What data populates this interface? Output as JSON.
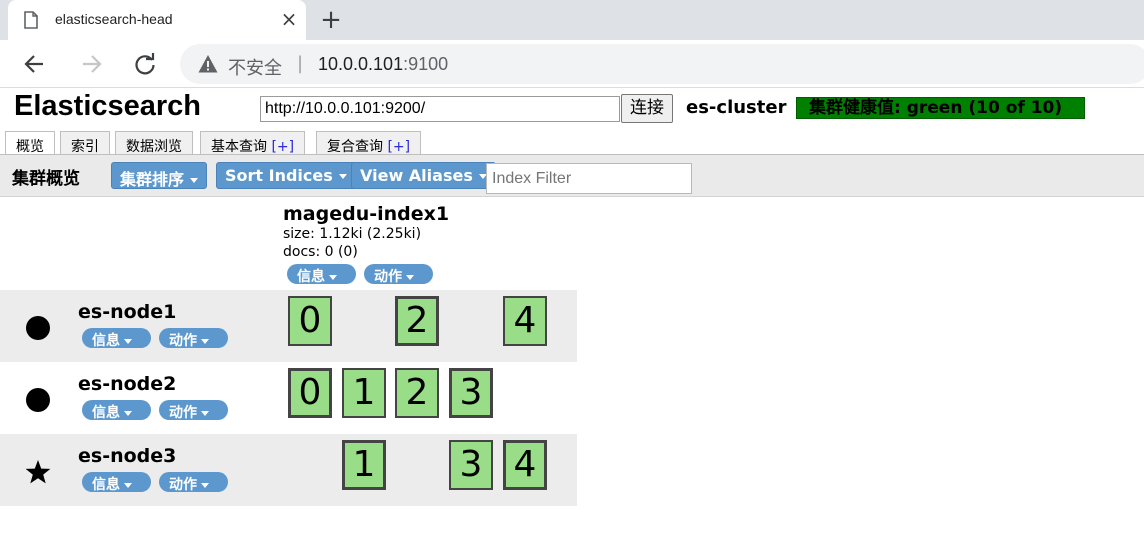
{
  "browser": {
    "tab_title": "elasticsearch-head",
    "tab_close": "×",
    "new_tab": "+",
    "security_label": "不安全",
    "separator": "|",
    "url_host": "10.0.0.101",
    "url_port": ":9100"
  },
  "app": {
    "title": "Elasticsearch",
    "connection_url": "http://10.0.0.101:9200/",
    "connect_label": "连接",
    "cluster_name": "es-cluster",
    "health_text": "集群健康值: green (10 of 10)",
    "health_color": "#008000"
  },
  "tabs": [
    {
      "label": "概览",
      "plus": ""
    },
    {
      "label": "索引",
      "plus": ""
    },
    {
      "label": "数据浏览",
      "plus": ""
    },
    {
      "label": "基本查询",
      "plus": "[+]"
    },
    {
      "label": "复合查询",
      "plus": "[+]"
    }
  ],
  "overview": {
    "label": "集群概览",
    "sort_cluster": "集群排序",
    "sort_indices": "Sort Indices",
    "view_aliases": "View Aliases",
    "filter_placeholder": "Index Filter"
  },
  "index": {
    "name": "magedu-index1",
    "size": "size: 1.12ki (2.25ki)",
    "docs": "docs: 0 (0)",
    "info_label": "信息",
    "action_label": "动作"
  },
  "nodes": [
    {
      "name": "es-node1",
      "symbol": "circle-icon",
      "info_label": "信息",
      "action_label": "动作",
      "shards": [
        "0",
        "2",
        "4"
      ]
    },
    {
      "name": "es-node2",
      "symbol": "circle-icon",
      "info_label": "信息",
      "action_label": "动作",
      "shards": [
        "0",
        "1",
        "2",
        "3"
      ]
    },
    {
      "name": "es-node3",
      "symbol": "star-icon",
      "info_label": "信息",
      "action_label": "动作",
      "shards": [
        "1",
        "3",
        "4"
      ]
    }
  ],
  "colors": {
    "shard_fill": "#99dd88",
    "button_blue": "#5c98cd"
  }
}
